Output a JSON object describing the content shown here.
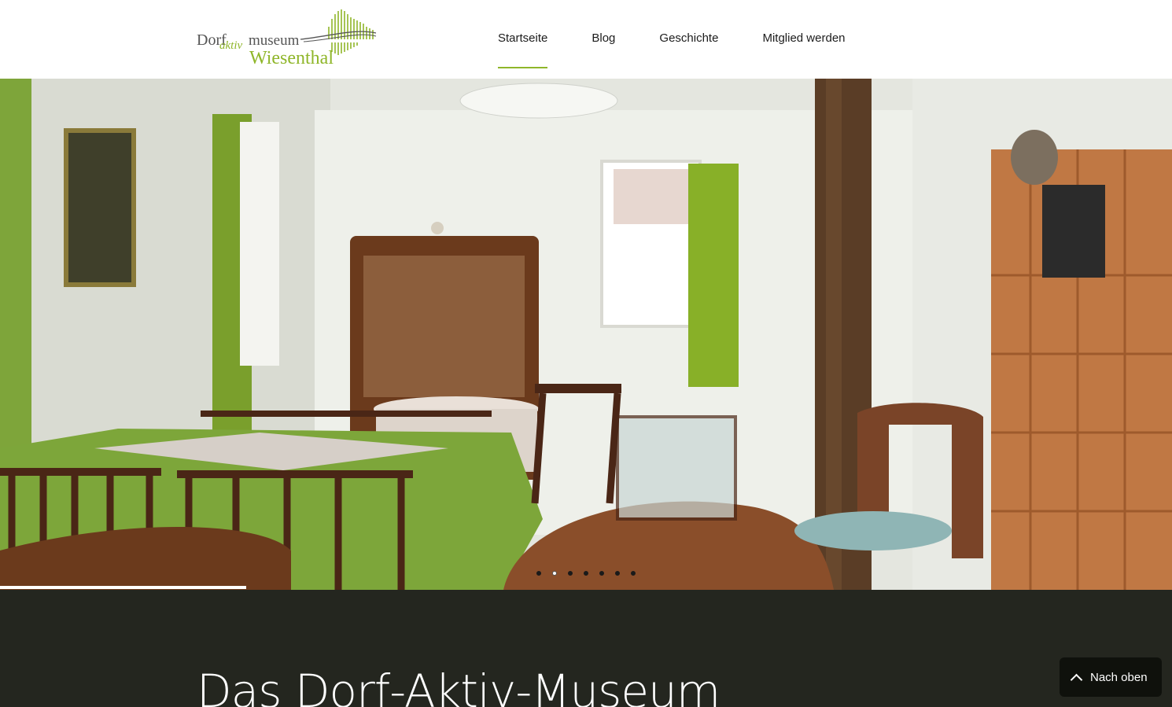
{
  "logo": {
    "word_dorf": "Dorf",
    "word_aktiv": "aktiv",
    "word_museum": "museum",
    "word_place": "Wiesenthal",
    "accent": "#8fb62a"
  },
  "nav": {
    "items": [
      {
        "label": "Startseite",
        "active": true
      },
      {
        "label": "Blog",
        "active": false
      },
      {
        "label": "Geschichte",
        "active": false
      },
      {
        "label": "Mitglied werden",
        "active": false
      }
    ]
  },
  "slider": {
    "slide_count": 7,
    "active_slide": 2,
    "progress": 0.21,
    "image_description": "museum-room-photo"
  },
  "intro": {
    "title": "Das Dorf-Aktiv-Museum"
  },
  "back_to_top": {
    "label": "Nach oben",
    "icon": "chevron-up-icon"
  },
  "colors": {
    "accent": "#8fb62a",
    "dark_section": "#24261f",
    "button_bg": "#0f110c"
  }
}
